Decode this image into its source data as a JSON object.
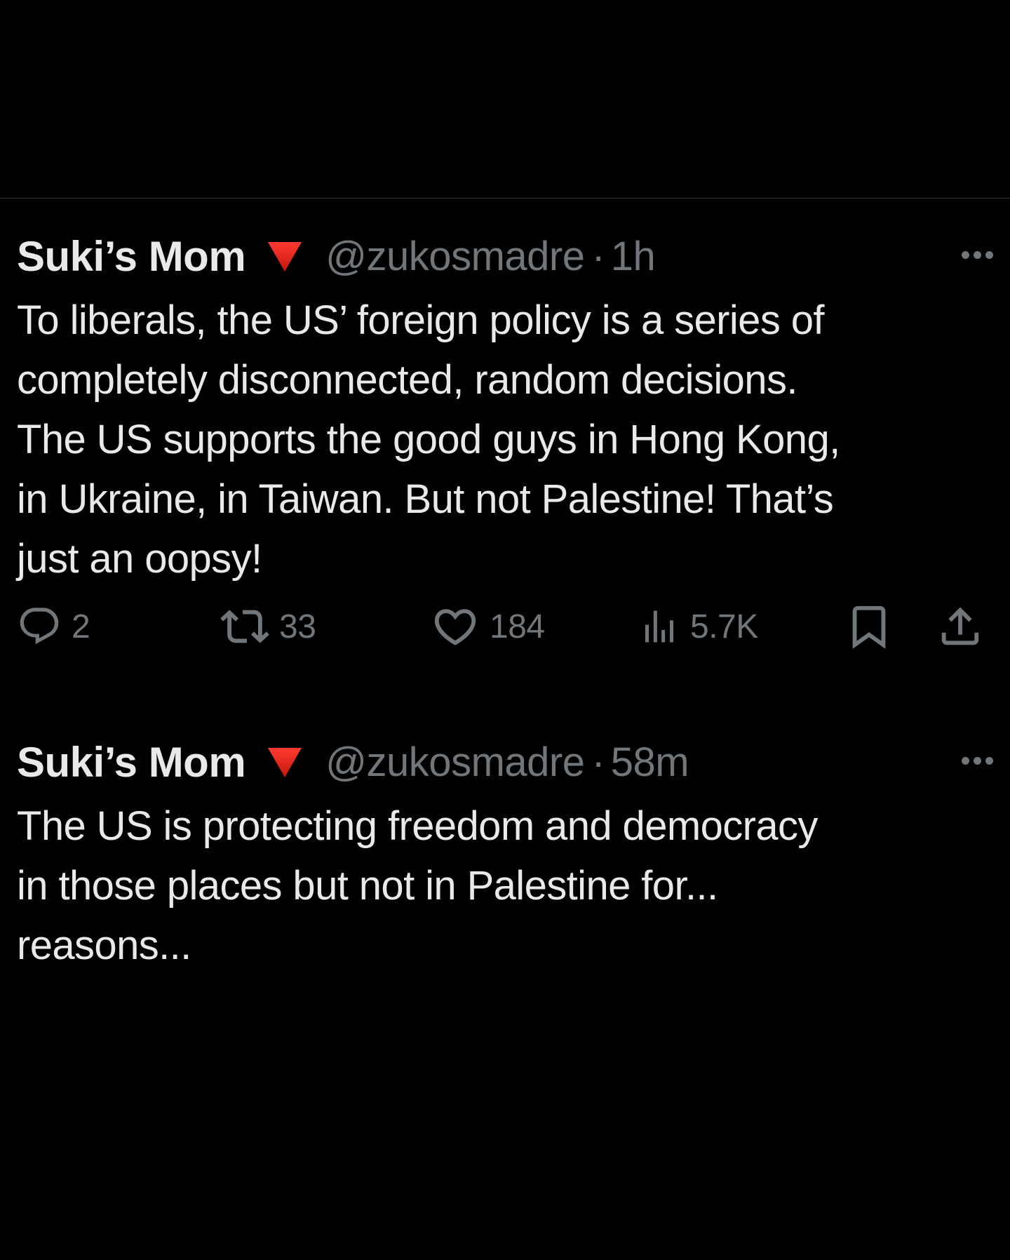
{
  "tweets": [
    {
      "display_name": "Suki’s Mom",
      "flag_icon": "red-triangle-down-icon",
      "handle": "@zukosmadre",
      "separator": "·",
      "time": "1h",
      "text_lines": [
        "To liberals, the US’ foreign policy is a series of",
        "completely disconnected, random decisions.",
        "The US supports the good guys in Hong Kong,",
        "in Ukraine, in Taiwan. But not Palestine! That’s",
        "just an oopsy!"
      ],
      "actions": {
        "replies": "2",
        "retweets": "33",
        "likes": "184",
        "views": "5.7K"
      }
    },
    {
      "display_name": "Suki’s Mom",
      "flag_icon": "red-triangle-down-icon",
      "handle": "@zukosmadre",
      "separator": "·",
      "time": "58m",
      "text_lines": [
        "The US is protecting freedom and democracy",
        "in those places but not in Palestine for...",
        "reasons..."
      ]
    }
  ],
  "colors": {
    "background": "#000000",
    "text": "#e7e9ea",
    "muted": "#71767b",
    "flag": "#e0201c",
    "divider": "#2f3336"
  }
}
